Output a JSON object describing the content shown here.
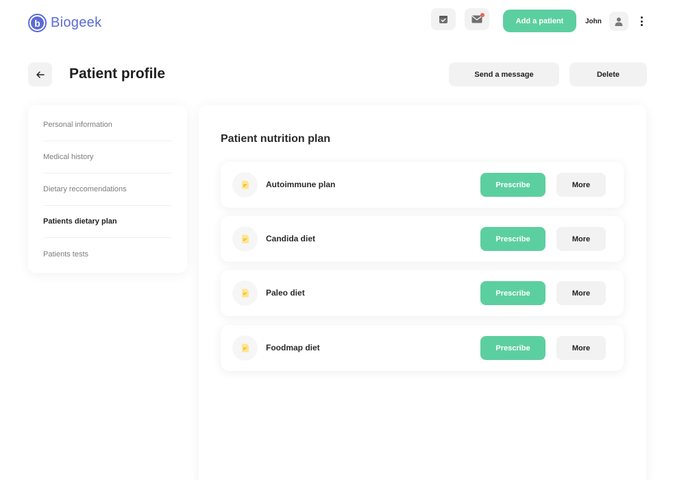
{
  "header": {
    "brand": "Biogeek",
    "brand_letter": "b",
    "add_patient_label": "Add a patient",
    "user_name": "John",
    "colors": {
      "brand": "#5b6bd6",
      "accent": "#5ccfa0",
      "notification": "#f0625a"
    }
  },
  "titlebar": {
    "title": "Patient profile",
    "send_message_label": "Send a message",
    "delete_label": "Delete"
  },
  "sidebar": {
    "items": [
      {
        "label": "Personal information"
      },
      {
        "label": "Medical history"
      },
      {
        "label": "Dietary reccomendations"
      },
      {
        "label": "Patients dietary plan",
        "active": true
      },
      {
        "label": "Patients tests"
      }
    ]
  },
  "main": {
    "section_title": "Patient nutrition plan",
    "plans": [
      {
        "name": "Autoimmune plan",
        "prescribe_label": "Prescribe",
        "more_label": "More"
      },
      {
        "name": "Candida diet",
        "prescribe_label": "Prescribe",
        "more_label": "More"
      },
      {
        "name": "Paleo diet",
        "prescribe_label": "Prescribe",
        "more_label": "More"
      },
      {
        "name": "Foodmap diet",
        "prescribe_label": "Prescribe",
        "more_label": "More"
      }
    ]
  },
  "icons": {
    "calendar": "calendar-check-icon",
    "mail": "mail-icon",
    "user": "user-icon",
    "more": "kebab-menu-icon",
    "back": "arrow-left-icon",
    "plan": "note-icon"
  }
}
